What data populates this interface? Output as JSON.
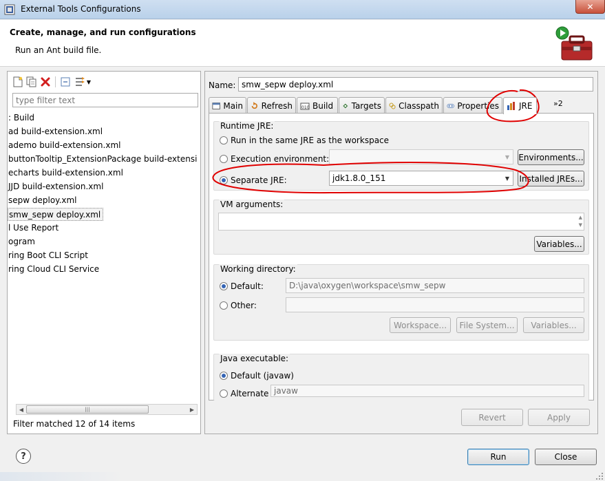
{
  "window": {
    "title": "External Tools Configurations",
    "close_glyph": "✕"
  },
  "header": {
    "title": "Create, manage, and run configurations",
    "subtitle": "Run an Ant build file."
  },
  "left": {
    "filter_placeholder": "type filter text",
    "items": [
      {
        "label": ": Build",
        "selected": false
      },
      {
        "label": "ad build-extension.xml",
        "selected": false
      },
      {
        "label": "ademo build-extension.xml",
        "selected": false
      },
      {
        "label": "buttonTooltip_ExtensionPackage build-extensi",
        "selected": false
      },
      {
        "label": "echarts build-extension.xml",
        "selected": false
      },
      {
        "label": "JJD build-extension.xml",
        "selected": false
      },
      {
        "label": "sepw deploy.xml",
        "selected": false
      },
      {
        "label": "smw_sepw deploy.xml",
        "selected": true
      },
      {
        "label": "l Use Report",
        "selected": false
      },
      {
        "label": "ogram",
        "selected": false
      },
      {
        "label": "ring Boot CLI Script",
        "selected": false
      },
      {
        "label": "ring Cloud CLI Service",
        "selected": false
      }
    ],
    "scroll_thumb_grip": "|||",
    "status": "Filter matched 12 of 14 items"
  },
  "right": {
    "name_label": "Name:",
    "name_value": "smw_sepw deploy.xml",
    "tabs": [
      {
        "label": "Main",
        "icon": "main-tab-icon"
      },
      {
        "label": "Refresh",
        "icon": "refresh-icon"
      },
      {
        "label": "Build",
        "icon": "build-icon"
      },
      {
        "label": "Targets",
        "icon": "targets-icon"
      },
      {
        "label": "Classpath",
        "icon": "classpath-icon"
      },
      {
        "label": "Properties",
        "icon": "properties-icon"
      },
      {
        "label": "JRE",
        "icon": "jre-icon"
      }
    ],
    "tab_overflow": "»2",
    "jre": {
      "group_label": "Runtime JRE:",
      "same_jre": "Run in the same JRE as the workspace",
      "exec_env": "Execution environment:",
      "environments_button": "Environments...",
      "separate_jre": "Separate JRE:",
      "separate_jre_value": "jdk1.8.0_151",
      "installed_jres_button": "Installed JREs..."
    },
    "vm": {
      "group_label": "VM arguments:",
      "variables_button": "Variables..."
    },
    "workdir": {
      "group_label": "Working directory:",
      "default_label": "Default:",
      "default_value": "D:\\java\\oxygen\\workspace\\smw_sepw",
      "other_label": "Other:",
      "workspace_button": "Workspace...",
      "filesystem_button": "File System...",
      "variables_button": "Variables..."
    },
    "java_exec": {
      "group_label": "Java executable:",
      "default_label": "Default (javaw)",
      "alternate_label": "Alternate",
      "alternate_value": "javaw"
    },
    "revert_button": "Revert",
    "apply_button": "Apply"
  },
  "footer": {
    "help_glyph": "?",
    "run_button": "Run",
    "close_button": "Close"
  },
  "colors": {
    "annotation": "#e00000",
    "radio_selected": "#3464b4",
    "disabled_text": "#8d8d8d"
  }
}
